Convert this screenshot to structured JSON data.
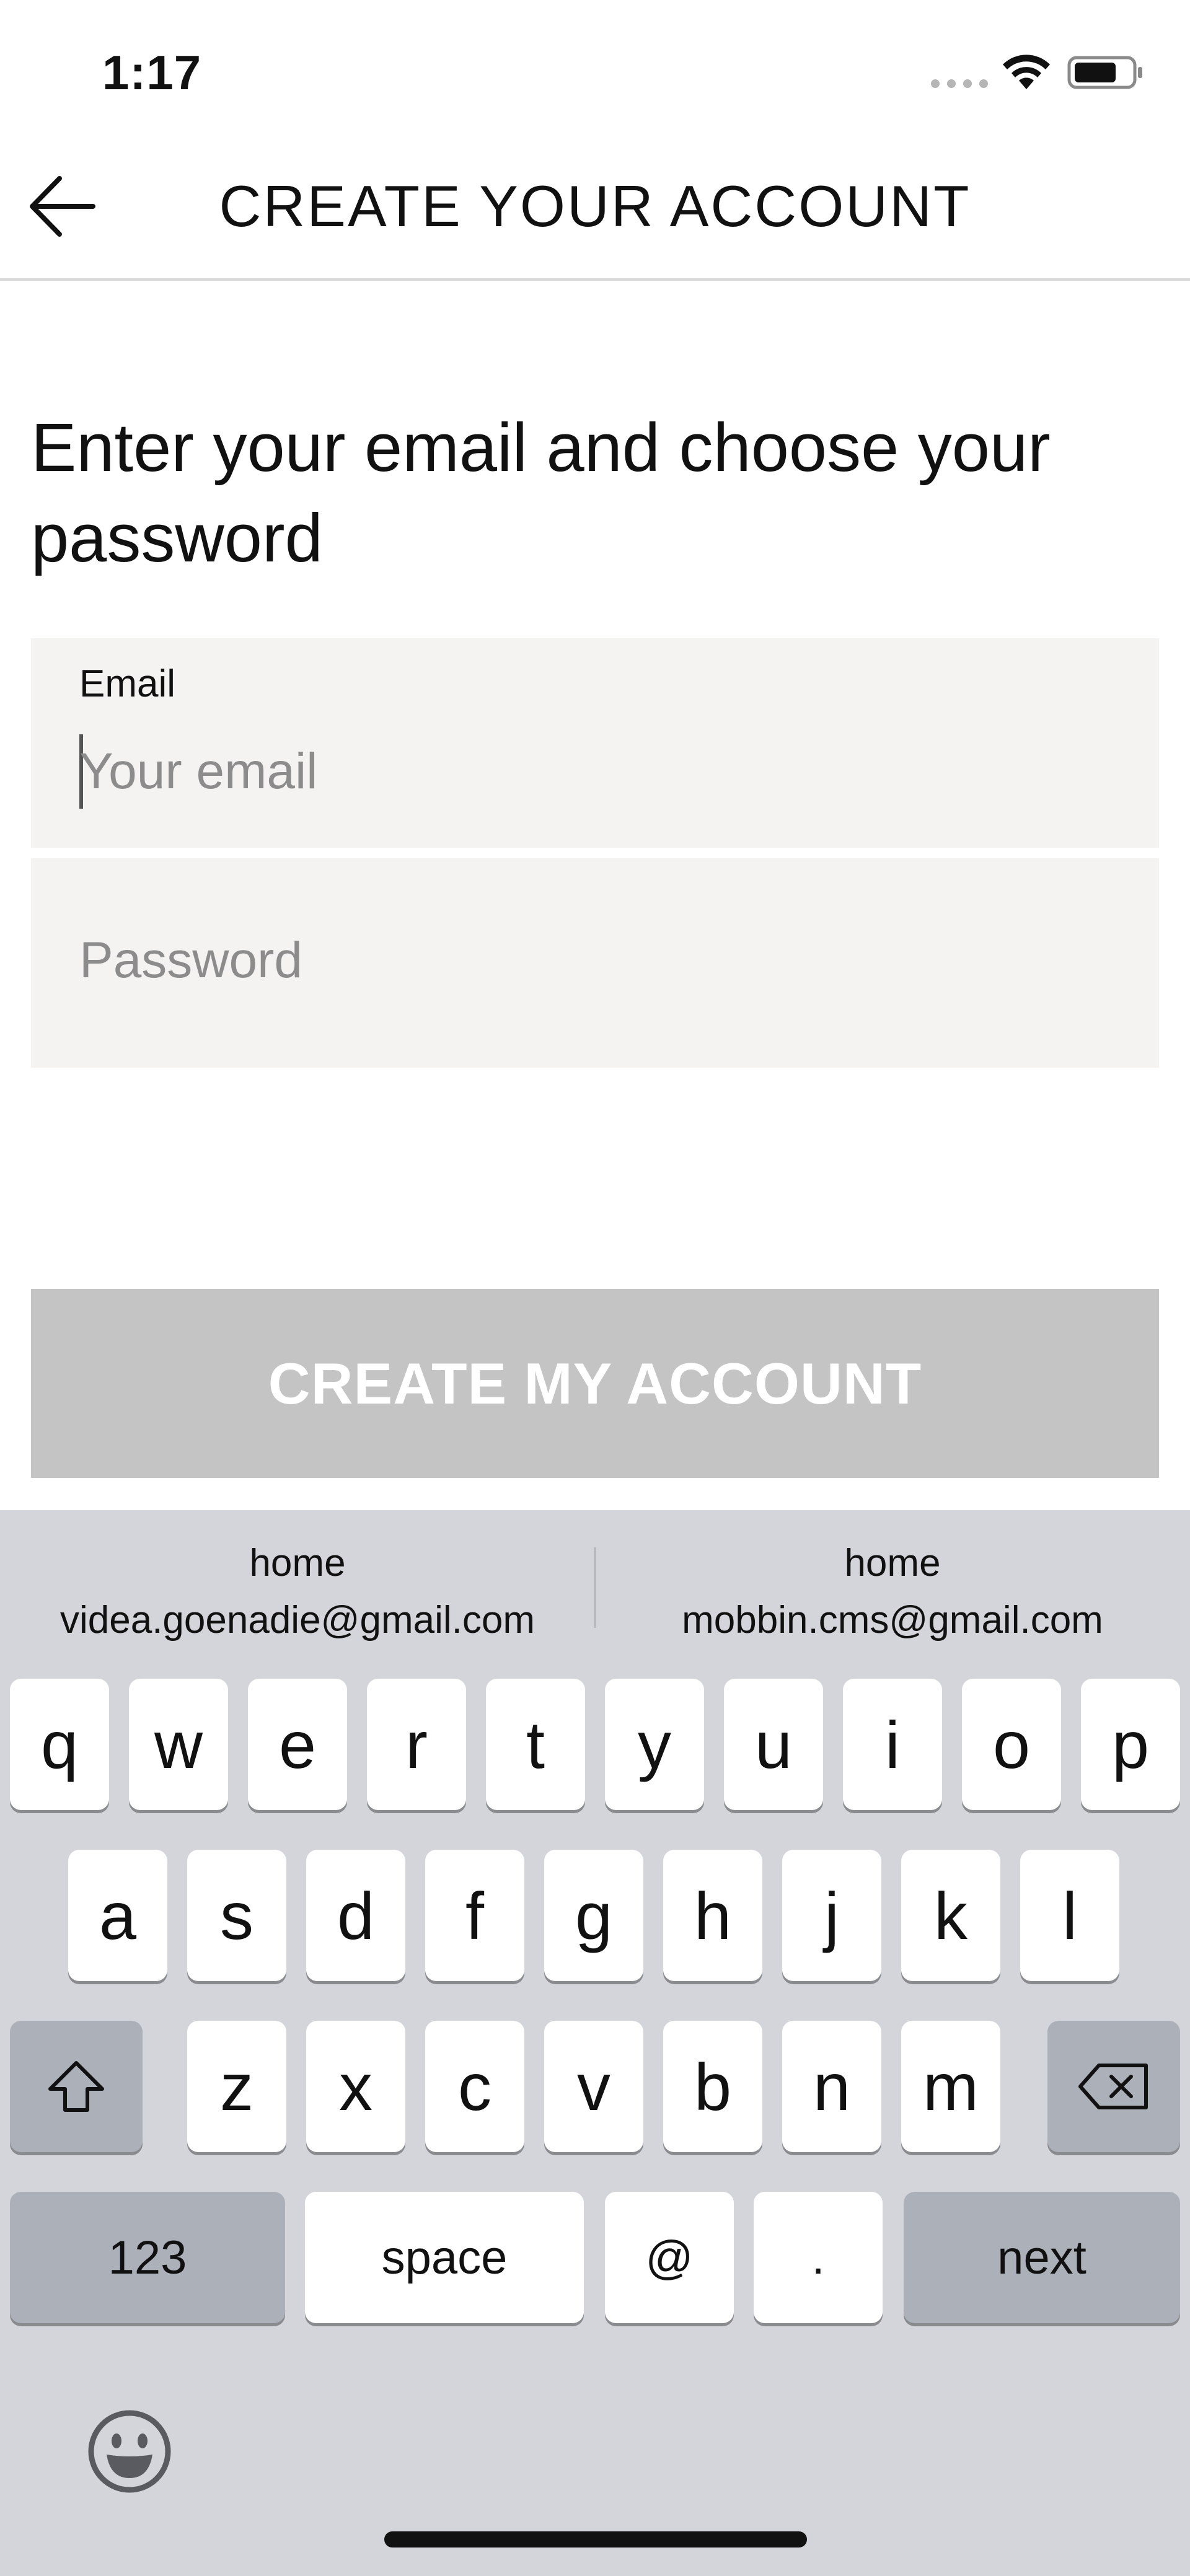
{
  "status_bar": {
    "time": "1:17"
  },
  "header": {
    "title": "CREATE YOUR ACCOUNT"
  },
  "heading": "Enter your email and choose your password",
  "form": {
    "email": {
      "label": "Email",
      "placeholder": "Your email",
      "value": ""
    },
    "password": {
      "placeholder": "Password",
      "value": ""
    },
    "submit_label": "CREATE MY ACCOUNT"
  },
  "keyboard": {
    "suggestions": [
      {
        "label": "home",
        "email": "videa.goenadie@gmail.com"
      },
      {
        "label": "home",
        "email": "mobbin.cms@gmail.com"
      }
    ],
    "row1": [
      "q",
      "w",
      "e",
      "r",
      "t",
      "y",
      "u",
      "i",
      "o",
      "p"
    ],
    "row2": [
      "a",
      "s",
      "d",
      "f",
      "g",
      "h",
      "j",
      "k",
      "l"
    ],
    "row3": [
      "z",
      "x",
      "c",
      "v",
      "b",
      "n",
      "m"
    ],
    "numbers_label": "123",
    "space_label": "space",
    "at_label": "@",
    "dot_label": ".",
    "next_label": "next"
  },
  "colors": {
    "field_background": "#f4f3f2",
    "button_disabled": "#c4c4c4",
    "keyboard_background": "#d4d5da"
  }
}
